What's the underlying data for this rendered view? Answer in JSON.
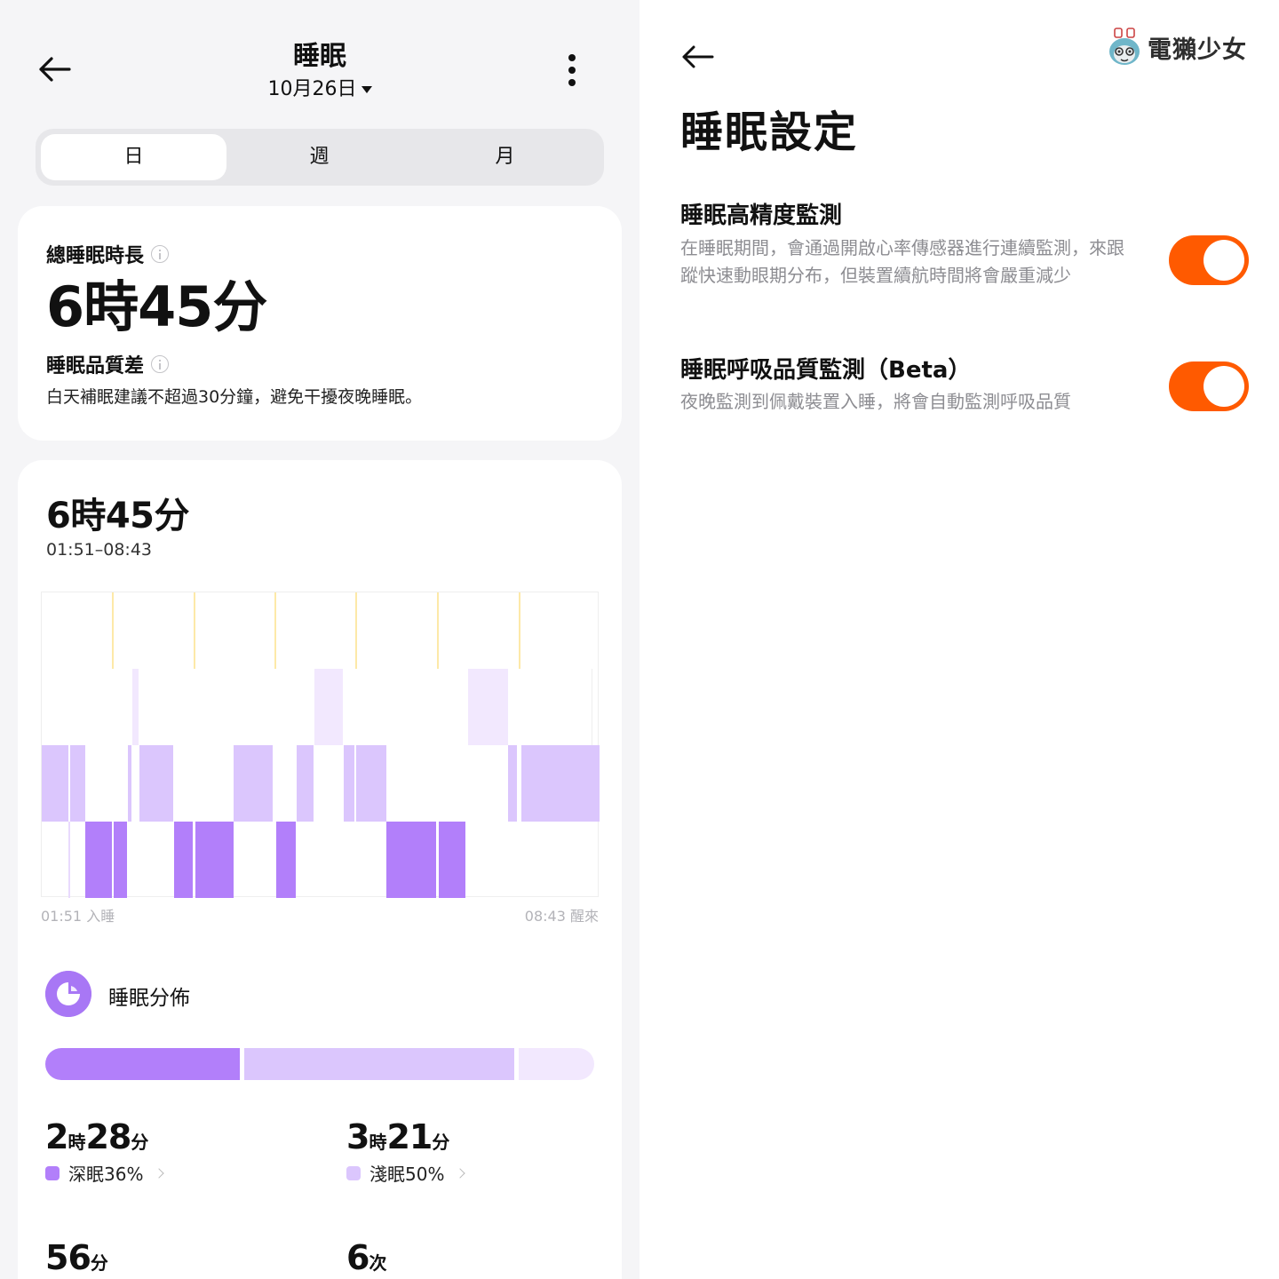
{
  "left": {
    "header": {
      "title": "睡眠",
      "date": "10月26日"
    },
    "tabs": [
      {
        "label": "日",
        "active": true
      },
      {
        "label": "週",
        "active": false
      },
      {
        "label": "月",
        "active": false
      }
    ],
    "summary_card": {
      "total_label": "總睡眠時長",
      "total_value": "6時45分",
      "quality_label": "睡眠品質差",
      "advice": "白天補眠建議不超過30分鐘，避免干擾夜晚睡眠。"
    },
    "detail_card": {
      "duration": "6時45分",
      "time_range": "01:51–08:43",
      "axis_start": "01:51 入睡",
      "axis_end": "08:43 醒來",
      "distribution_title": "睡眠分佈",
      "stats": [
        {
          "value": "2",
          "unit1": "時",
          "value2": "28",
          "unit2": "分",
          "legend": "深眠36%",
          "color": "#b27ffa"
        },
        {
          "value": "3",
          "unit1": "時",
          "value2": "21",
          "unit2": "分",
          "legend": "淺眠50%",
          "color": "#dbc6fd"
        },
        {
          "value": "56",
          "unit1": "分",
          "value2": "",
          "unit2": "",
          "legend": "",
          "color": "#f2e8fe"
        },
        {
          "value": "6",
          "unit1": "次",
          "value2": "",
          "unit2": "",
          "legend": "",
          "color": ""
        }
      ]
    }
  },
  "distribution_fractions": {
    "deep": 0.36,
    "light": 0.5,
    "rem": 0.14
  },
  "colors": {
    "deep": "#b27ffa",
    "light": "#dbc6fd",
    "rem": "#f2e8fe",
    "awake": "#fde9a8",
    "accent": "#ff5a00"
  },
  "right": {
    "title": "睡眠設定",
    "logo_text": "電獺少女",
    "settings": [
      {
        "title": "睡眠高精度監測",
        "description": "在睡眠期間，會通過開啟心率傳感器進行連續監測，來跟蹤快速動眼期分布，但裝置續航時間將會嚴重減少",
        "enabled": true
      },
      {
        "title": "睡眠呼吸品質監測（Beta）",
        "description": "夜晚監測到佩戴裝置入睡，將會自動監測呼吸品質",
        "enabled": true
      }
    ]
  }
}
